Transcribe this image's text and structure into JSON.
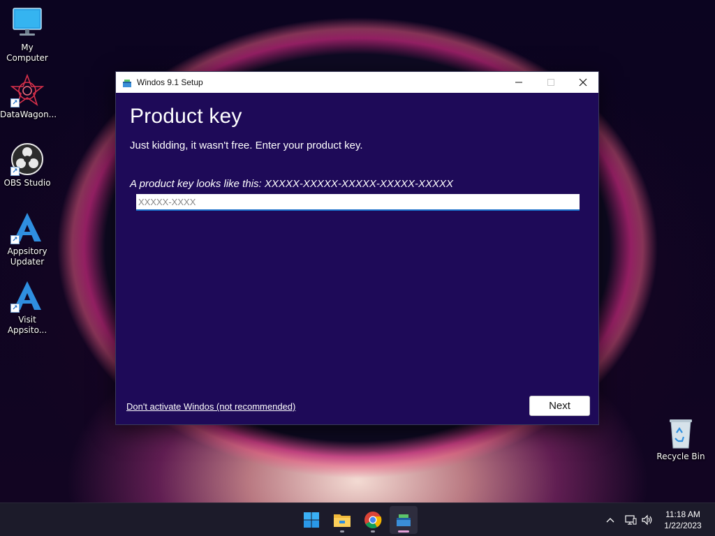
{
  "desktop": {
    "icons": [
      {
        "label": "My Computer",
        "icon": "monitor-icon"
      },
      {
        "label": "DataWagon...",
        "icon": "datawagon-icon"
      },
      {
        "label": "OBS Studio",
        "icon": "obs-icon"
      },
      {
        "label": "Appsitory Updater",
        "icon": "appsitory-icon"
      },
      {
        "label": "Visit Appsito...",
        "icon": "appsitory-icon"
      },
      {
        "label": "Recycle Bin",
        "icon": "recycle-bin-icon"
      }
    ]
  },
  "window": {
    "title": "Windos 9.1 Setup",
    "heading": "Product key",
    "subtitle": "Just kidding, it wasn't free. Enter your product key.",
    "hint": "A product key looks like this: XXXXX-XXXXX-XXXXX-XXXXX-XXXXX",
    "input_placeholder": "XXXXX-XXXX",
    "input_value": "",
    "skip_link": "Don't activate Windos (not recommended)",
    "next_label": "Next"
  },
  "taskbar": {
    "apps": [
      "start-icon",
      "file-explorer-icon",
      "chrome-icon",
      "setup-icon"
    ],
    "active_app": "setup-icon",
    "tray_icons": [
      "chevron-up-icon",
      "network-icon",
      "volume-icon"
    ],
    "time": "11:18 AM",
    "date": "1/22/2023"
  },
  "colors": {
    "dialog_bg": "#1e0a58",
    "input_underline": "#1a6fc9",
    "taskbar_bg": "#1c1b2a"
  }
}
